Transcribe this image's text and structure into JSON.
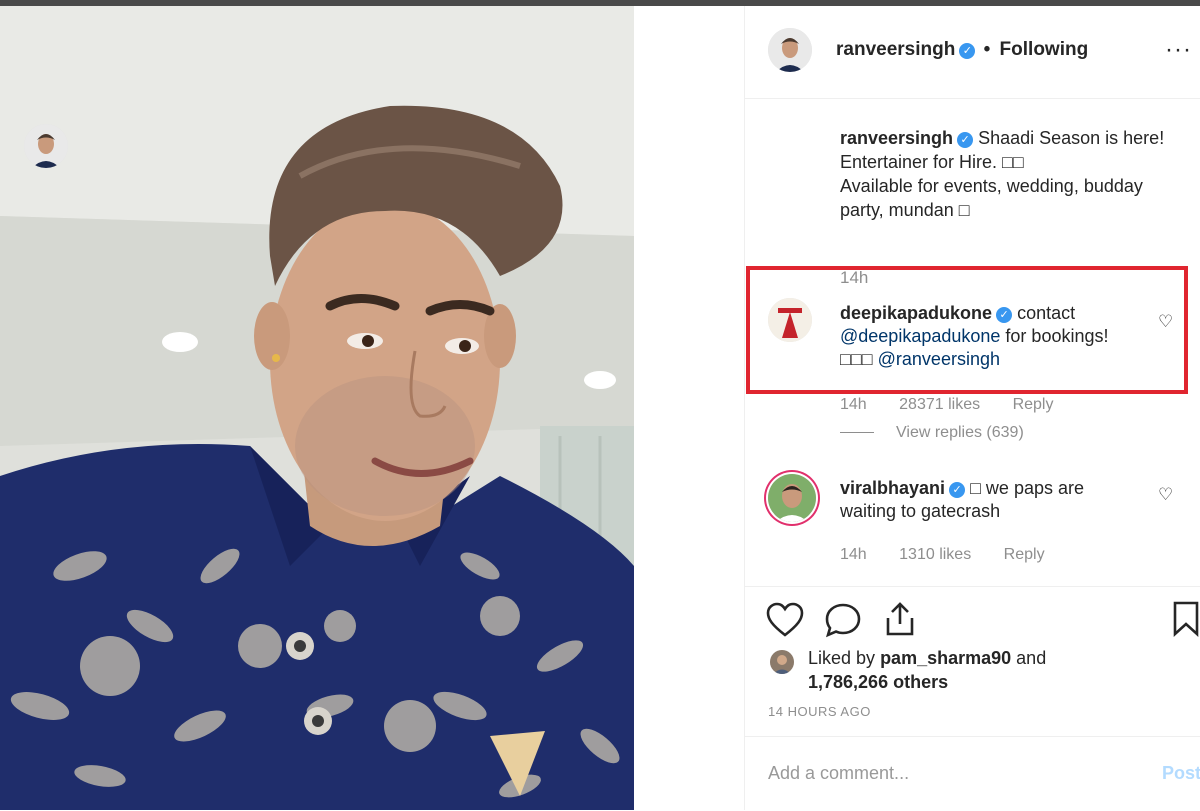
{
  "header": {
    "username": "ranveersingh",
    "separator": "•",
    "follow_state": "Following",
    "more_label": "···"
  },
  "caption": {
    "username": "ranveersingh",
    "text_line1": "Shaadi Season is here!",
    "text_line2": "Entertainer for Hire. □□",
    "text_line3": "Available for events, wedding, budday party, mundan □",
    "time": "14h"
  },
  "comments": [
    {
      "username": "deepikapadukone",
      "text_before": "contact",
      "mention1": "@deepikapadukone",
      "text_middle": "for bookings!□□□",
      "mention2": "@ranveersingh",
      "time": "14h",
      "likes": "28371 likes",
      "reply_label": "Reply",
      "view_replies": "View replies (639)"
    },
    {
      "username": "viralbhayani",
      "text": "□ we paps are waiting to gatecrash",
      "time": "14h",
      "likes": "1310 likes",
      "reply_label": "Reply"
    }
  ],
  "likes": {
    "prefix": "Liked by",
    "liker": "pam_sharma90",
    "connector": "and",
    "others": "1,786,266 others"
  },
  "posted": "14 HOURS AGO",
  "comment_box": {
    "placeholder": "Add a comment...",
    "post_label": "Post"
  },
  "icons": {
    "like": "heart-icon",
    "comment": "comment-bubble-icon",
    "share": "share-icon",
    "save": "bookmark-icon",
    "verified": "verified-badge-icon"
  },
  "colors": {
    "verified": "#3897f0",
    "highlight": "#e0252f",
    "mention": "#003569",
    "muted": "#8e8e8e"
  }
}
